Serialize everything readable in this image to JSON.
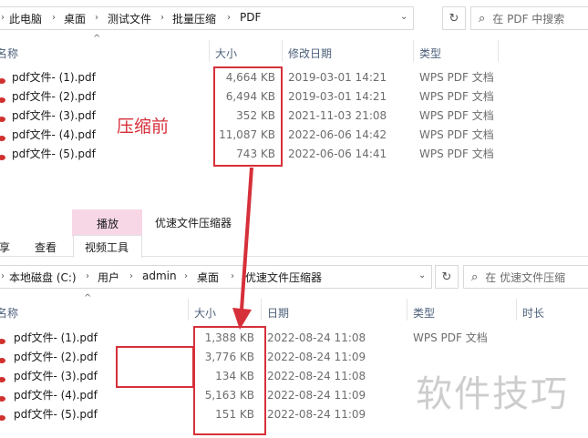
{
  "top_window": {
    "breadcrumb": [
      "此电脑",
      "桌面",
      "测试文件",
      "批量压缩",
      "PDF"
    ],
    "search_placeholder": "在 PDF 中搜索",
    "columns": [
      "名称",
      "大小",
      "修改日期",
      "类型"
    ],
    "files": [
      {
        "name": "pdf文件- (1).pdf",
        "size": "4,664 KB",
        "date": "2019-03-01 14:21",
        "type": "WPS PDF 文档"
      },
      {
        "name": "pdf文件- (2).pdf",
        "size": "6,494 KB",
        "date": "2019-03-01 14:21",
        "type": "WPS PDF 文档"
      },
      {
        "name": "pdf文件- (3).pdf",
        "size": "352 KB",
        "date": "2021-11-03 21:08",
        "type": "WPS PDF 文档"
      },
      {
        "name": "pdf文件- (4).pdf",
        "size": "11,087 KB",
        "date": "2022-06-06 14:42",
        "type": "WPS PDF 文档"
      },
      {
        "name": "pdf文件- (5).pdf",
        "size": "743 KB",
        "date": "2022-06-06 14:41",
        "type": "WPS PDF 文档"
      }
    ],
    "annotation": "压缩前"
  },
  "bottom_window": {
    "ribbon": {
      "context_tab": "播放",
      "title": "优速文件压缩器",
      "tabs": [
        "享",
        "查看",
        "视频工具"
      ]
    },
    "breadcrumb": [
      "本地磁盘 (C:)",
      "用户",
      "admin",
      "桌面",
      "优速文件压缩器"
    ],
    "search_placeholder": "在 优速文件压缩",
    "columns": [
      "名称",
      "大小",
      "日期",
      "类型",
      "时长"
    ],
    "files": [
      {
        "name": "pdf文件- (1).pdf",
        "size": "1,388 KB",
        "date": "2022-08-24 11:08",
        "type": "WPS PDF 文档"
      },
      {
        "name": "pdf文件- (2).pdf",
        "size": "3,776 KB",
        "date": "2022-08-24 11:09",
        "type": ""
      },
      {
        "name": "pdf文件- (3).pdf",
        "size": "134 KB",
        "date": "2022-08-24 11:08",
        "type": ""
      },
      {
        "name": "pdf文件- (4).pdf",
        "size": "5,163 KB",
        "date": "2022-08-24 11:09",
        "type": ""
      },
      {
        "name": "pdf文件- (5).pdf",
        "size": "151 KB",
        "date": "2022-08-24 11:09",
        "type": ""
      }
    ]
  },
  "watermark": "软件技巧",
  "colors": {
    "annotation_red": "#d6303a",
    "header_text": "#4c607a",
    "ribbon_pink": "#f7d7e6"
  }
}
